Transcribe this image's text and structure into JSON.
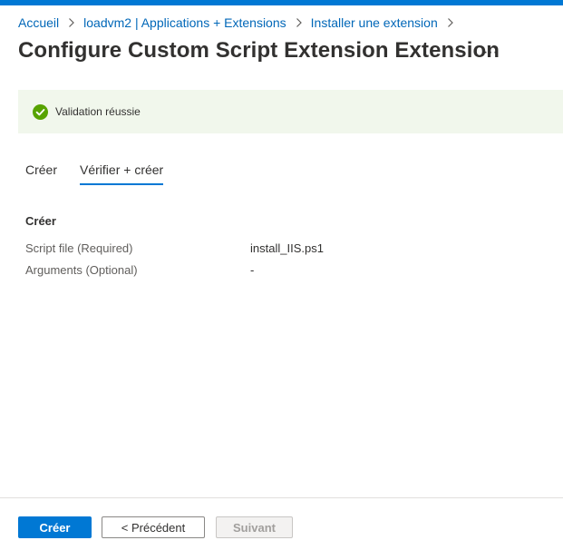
{
  "breadcrumb": [
    {
      "label": "Accueil"
    },
    {
      "label": "loadvm2 | Applications + Extensions"
    },
    {
      "label": "Installer une extension"
    }
  ],
  "title": "Configure Custom Script Extension Extension",
  "more_label": "···",
  "banner": {
    "text": "Validation réussie",
    "color": "#f1f7ec",
    "icon": "check-circle-icon",
    "icon_color": "#57a300"
  },
  "tabs": [
    {
      "label": "Créer",
      "active": false
    },
    {
      "label": "Vérifier + créer",
      "active": true
    }
  ],
  "section": {
    "title": "Créer",
    "rows": [
      {
        "label": "Script file (Required)",
        "value": "install_IIS.ps1"
      },
      {
        "label": "Arguments (Optional)",
        "value": "-"
      }
    ]
  },
  "footer": {
    "create_label": "Créer",
    "previous_label": "< Précédent",
    "next_label": "Suivant"
  },
  "colors": {
    "accent": "#0078d4",
    "link": "#0067b8"
  }
}
